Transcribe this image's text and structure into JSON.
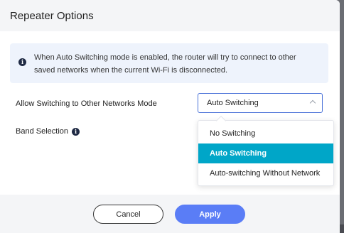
{
  "dialog": {
    "title": "Repeater Options",
    "info_text": "When Auto Switching mode is enabled, the router will try to connect to other saved networks when the current Wi-Fi is disconnected.",
    "info_glyph": "i"
  },
  "fields": {
    "switching_mode_label": "Allow Switching to Other Networks Mode",
    "switching_mode_value": "Auto Switching",
    "band_selection_label": "Band Selection"
  },
  "dropdown": {
    "options": [
      "No Switching",
      "Auto Switching",
      "Auto-switching Without Network"
    ],
    "selected": "Auto Switching"
  },
  "buttons": {
    "cancel_label": "Cancel",
    "apply_label": "Apply"
  },
  "colors": {
    "accent": "#5a7df6",
    "selected_option": "#00a6c8",
    "info_bg": "#eef3fc"
  }
}
